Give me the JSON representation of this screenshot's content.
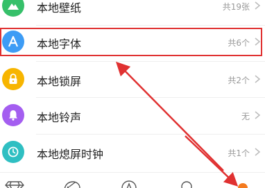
{
  "list": {
    "items": [
      {
        "label": "本地壁纸",
        "count": "共19张",
        "icon": "mountain-icon",
        "color": "#36c06a"
      },
      {
        "label": "本地字体",
        "count": "共6个",
        "icon": "letter-a-icon",
        "color": "#3d9cf5"
      },
      {
        "label": "本地锁屏",
        "count": "共2个",
        "icon": "lock-icon",
        "color": "#f7b500"
      },
      {
        "label": "本地铃声",
        "count": "无",
        "icon": "bell-icon",
        "color": "#a45ef0"
      },
      {
        "label": "本地熄屏时钟",
        "count": "共1个",
        "icon": "clock-icon",
        "color": "#2fbfc2"
      }
    ]
  },
  "tabbar": {
    "tabs": [
      {
        "icon": "diamond-icon"
      },
      {
        "icon": "brush-icon"
      },
      {
        "icon": "triangle-a-icon"
      },
      {
        "icon": "search-icon"
      },
      {
        "icon": "profile-dot-icon",
        "active_color": "#f47b20"
      }
    ]
  },
  "annotation": {
    "color": "#e03131"
  }
}
